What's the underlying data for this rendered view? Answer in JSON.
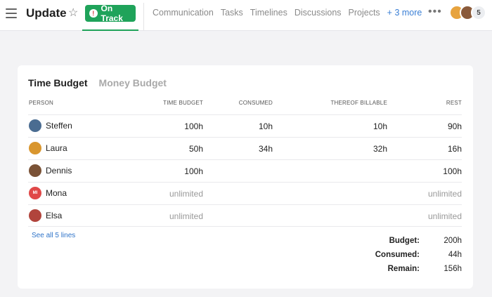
{
  "header": {
    "title": "Update",
    "status_label": "On Track",
    "status_color": "#1fa35a",
    "nav_tabs": [
      "Communication",
      "Tasks",
      "Timelines",
      "Discussions",
      "Projects"
    ],
    "more_label": "+ 3 more",
    "member_count": "5"
  },
  "budget": {
    "tabs": [
      "Time Budget",
      "Money Budget"
    ],
    "columns": {
      "person": "PERSON",
      "time_budget": "TIME BUDGET",
      "consumed": "CONSUMED",
      "billable": "THEREOF BILLABLE",
      "rest": "REST"
    },
    "rows": [
      {
        "name": "Steffen",
        "budget": "100h",
        "consumed": "10h",
        "billable": "10h",
        "rest": "90h"
      },
      {
        "name": "Laura",
        "budget": "50h",
        "consumed": "34h",
        "billable": "32h",
        "rest": "16h"
      },
      {
        "name": "Dennis",
        "budget": "100h",
        "consumed": "",
        "billable": "",
        "rest": "100h"
      },
      {
        "name": "Mona",
        "budget": "unlimited",
        "consumed": "",
        "billable": "",
        "rest": "unlimited"
      },
      {
        "name": "Elsa",
        "budget": "unlimited",
        "consumed": "",
        "billable": "",
        "rest": "unlimited"
      }
    ],
    "see_all": "See all 5 lines",
    "summary": {
      "budget_label": "Budget:",
      "budget_value": "200h",
      "consumed_label": "Consumed:",
      "consumed_value": "44h",
      "remain_label": "Remain:",
      "remain_value": "156h"
    }
  },
  "icons": {
    "menu": "hamburger-icon",
    "favorite": "star-icon",
    "status": "alert-icon",
    "overflow": "more-dots-icon"
  }
}
